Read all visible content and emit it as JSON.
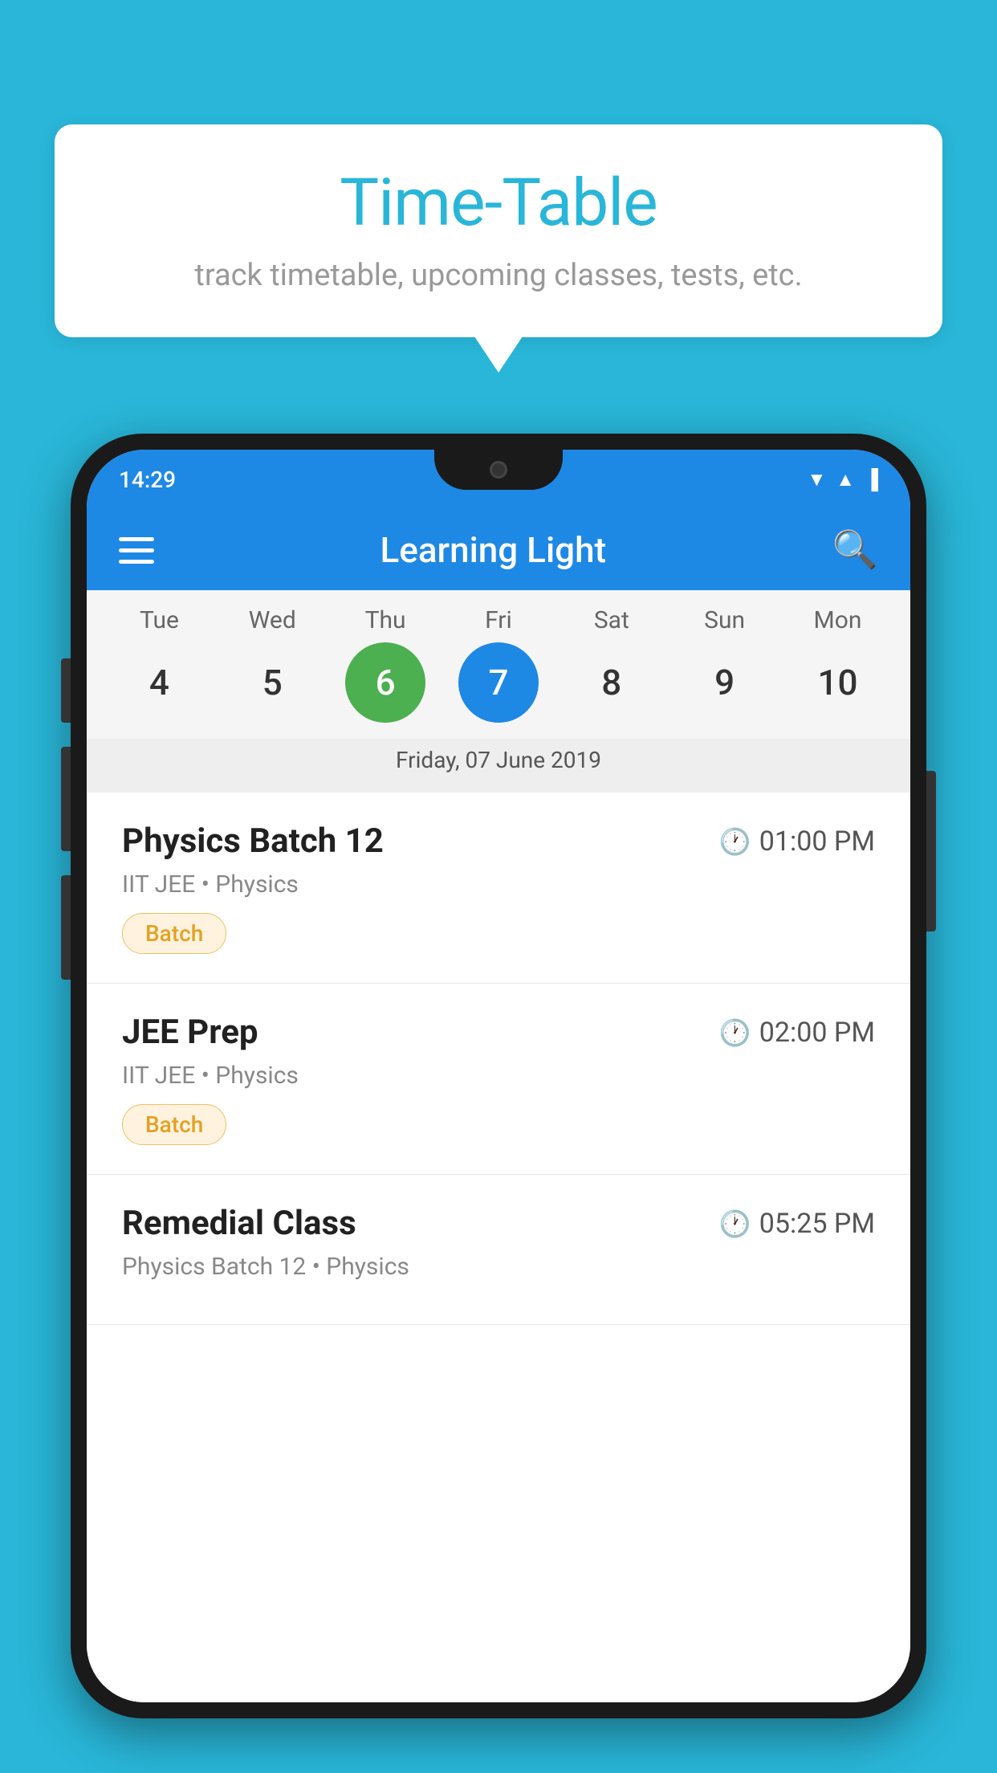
{
  "background": {
    "color": "#29b6d8"
  },
  "speech_bubble": {
    "title": "Time-Table",
    "subtitle": "track timetable, upcoming classes, tests, etc."
  },
  "app_bar": {
    "title": "Learning Light"
  },
  "status_bar": {
    "time": "14:29"
  },
  "calendar": {
    "days": [
      {
        "label": "Tue",
        "number": "4",
        "state": "normal"
      },
      {
        "label": "Wed",
        "number": "5",
        "state": "normal"
      },
      {
        "label": "Thu",
        "number": "6",
        "state": "today"
      },
      {
        "label": "Fri",
        "number": "7",
        "state": "selected"
      },
      {
        "label": "Sat",
        "number": "8",
        "state": "normal"
      },
      {
        "label": "Sun",
        "number": "9",
        "state": "normal"
      },
      {
        "label": "Mon",
        "number": "10",
        "state": "normal"
      }
    ],
    "selected_date_label": "Friday, 07 June 2019"
  },
  "schedule_items": [
    {
      "title": "Physics Batch 12",
      "time": "01:00 PM",
      "sub": "IIT JEE • Physics",
      "tag": "Batch"
    },
    {
      "title": "JEE Prep",
      "time": "02:00 PM",
      "sub": "IIT JEE • Physics",
      "tag": "Batch"
    },
    {
      "title": "Remedial Class",
      "time": "05:25 PM",
      "sub": "Physics Batch 12 • Physics",
      "tag": ""
    }
  ],
  "icons": {
    "hamburger": "☰",
    "search": "🔍",
    "clock": "🕐"
  }
}
